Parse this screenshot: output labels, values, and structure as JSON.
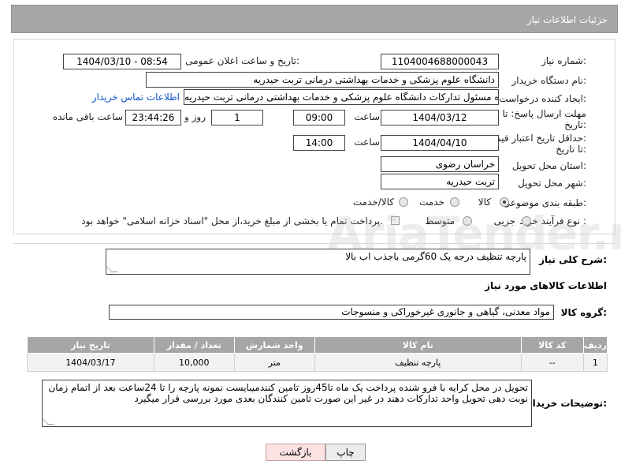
{
  "header": {
    "title": "جزئیات اطلاعات نیاز"
  },
  "form": {
    "need_number_label": "شماره نیاز:",
    "need_number": "1104004688000043",
    "announce_label": "تاریخ و ساعت اعلان عمومی:",
    "announce_value": "1404/03/10 - 08:54",
    "buyer_org_label": "نام دستگاه خریدار:",
    "buyer_org": "دانشگاه علوم پزشکی و خدمات بهداشتی درمانی تربت حیدریه",
    "creator_label": "ایجاد کننده درخواست:",
    "creator": "غلامحسن خردسوز زاوه مسئول تدارکات دانشگاه علوم پزشکی و خدمات بهداشتی درمانی تربت حیدریه",
    "contact_link": "اطلاعات تماس خریدار",
    "deadline_label_1": "مهلت ارسال پاسخ: تا",
    "deadline_label_2": "تاریخ:",
    "deadline_date": "1404/03/12",
    "time_label": "ساعت",
    "deadline_time": "09:00",
    "days_value": "1",
    "days_label": "روز و",
    "remaining_time": "23:44:26",
    "remaining_label": "ساعت باقی مانده",
    "validity_label_1": "حداقل تاریخ اعتبار قیمت:",
    "validity_label_2": "تا تاریخ:",
    "validity_date": "1404/04/10",
    "validity_time_label": "ساعت",
    "validity_time": "14:00",
    "province_label": "استان محل تحویل:",
    "province": "خراسان رضوی",
    "city_label": "شهر محل تحویل:",
    "city": "تربت حیدریه",
    "category_label": "طبقه بندی موضوعی:",
    "category_options": [
      "کالا",
      "خدمت",
      "کالا/خدمت"
    ],
    "process_label": "نوع فرآیند خرید :",
    "process_options": [
      "جزیی",
      "متوسط"
    ],
    "payment_note": "پرداخت تمام یا بخشی از مبلغ خرید،از محل \"اسناد خزانه اسلامی\" خواهد بود."
  },
  "watermark": "AriaTender.neT",
  "description": {
    "label": "شرح کلی نیاز:",
    "text": "پارچه تنظیف درجه یک 60گرمی باجذب اب بالا"
  },
  "goods": {
    "section_title": "اطلاعات کالاهای مورد نیاز",
    "group_label": "گروه کالا:",
    "group_value": "مواد معدنی، گیاهی و جانوری غیرخوراکی و منسوجات",
    "columns": [
      "ردیف",
      "کد کالا",
      "نام کالا",
      "واحد شمارش",
      "تعداد / مقدار",
      "تاریخ نیاز"
    ],
    "rows": [
      {
        "row": "1",
        "code": "--",
        "name": "پارچه تنظیف",
        "unit": "متر",
        "qty": "10,000",
        "date": "1404/03/17"
      }
    ]
  },
  "buyer_notes": {
    "label": "توضیحات خریدار:",
    "text": "تحویل در محل کرایه با فرو شنده پرداخت یک ماه تا45روز  تامین کنندمیبایست  نمونه  پارچه  را تا 24ساعت بعد از اتمام زمان نوبت دهی  تحویل واحد تدارکات دهند در غیر این صورت تامین کنندگان بعدی مورد بررسی قرار میگیرد"
  },
  "buttons": {
    "print": "چاپ",
    "back": "بازگشت"
  }
}
